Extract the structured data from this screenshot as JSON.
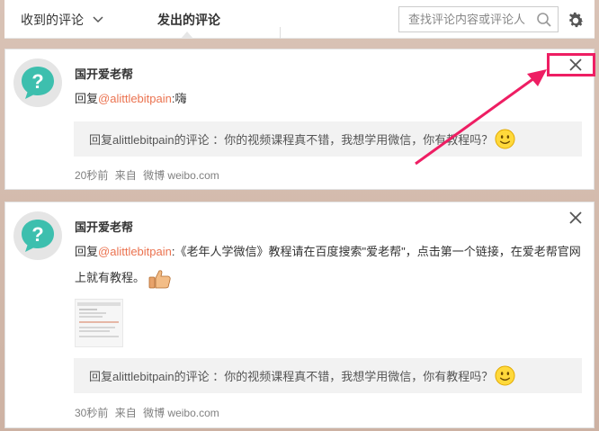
{
  "tabs": {
    "received_label": "收到的评论",
    "sent_label": "发出的评论"
  },
  "search": {
    "placeholder": "查找评论内容或评论人"
  },
  "comments": [
    {
      "author": "国开爱老帮",
      "reply_prefix": "回复",
      "mention": "@alittlebitpain",
      "reply_text": ":嗨",
      "quote": "回复alittlebitpain的评论 ：你的视频课程真不错，我想学用微信，你有教程吗？",
      "time": "20秒前",
      "source_prefix": "来自",
      "source": "微博 weibo.com"
    },
    {
      "author": "国开爱老帮",
      "reply_prefix": "回复",
      "mention": "@alittlebitpain",
      "reply_text_line1": ":《老年人学微信》教程请在百度搜索\"爱老帮\"，点击第一个链接，在爱老帮官网",
      "reply_text_line2": "上就有教程。",
      "quote": "回复alittlebitpain的评论 ：你的视频课程真不错，我想学用微信，你有教程吗？",
      "time": "30秒前",
      "source_prefix": "来自",
      "source": "微博 weibo.com"
    }
  ],
  "icons": {
    "avatar": "question-mark-avatar-icon",
    "close": "close-icon",
    "gear": "gear-icon",
    "search": "search-icon",
    "smile": "smile-emoji-icon",
    "thumb": "thumbs-up-emoji-icon"
  },
  "colors": {
    "mention": "#eb7350",
    "avatar_teal": "#3dbfae",
    "annotation": "#ee1e63"
  }
}
